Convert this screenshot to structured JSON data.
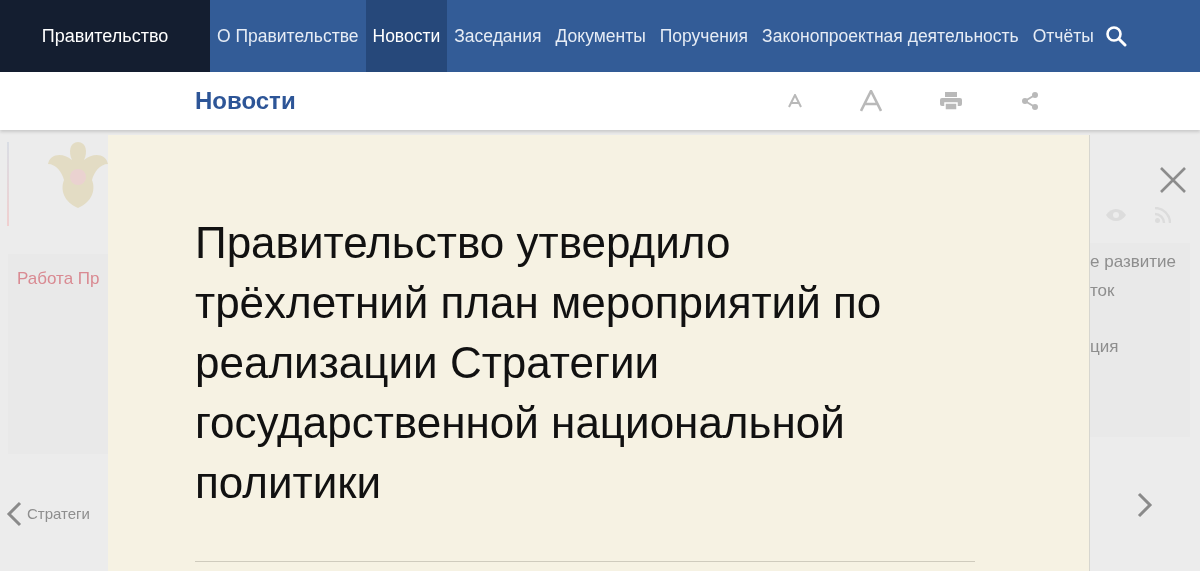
{
  "topnav": {
    "brand": "Правительство",
    "items": [
      {
        "label": "О Правительстве",
        "selected": false
      },
      {
        "label": "Новости",
        "selected": true
      },
      {
        "label": "Заседания",
        "selected": false
      },
      {
        "label": "Документы",
        "selected": false
      },
      {
        "label": "Поручения",
        "selected": false
      },
      {
        "label": "Законопроектная деятельность",
        "selected": false
      },
      {
        "label": "Отчёты",
        "selected": false
      }
    ]
  },
  "subheader": {
    "title": "Новости"
  },
  "background": {
    "left_texts": [
      {
        "text": "Работа Пр",
        "kind": "accent"
      },
      {
        "text": "Стратеги",
        "kind": "muted"
      }
    ],
    "right_texts": [
      "е развитие",
      "ток",
      "ция"
    ]
  },
  "article": {
    "headline": "Правительство утвердило трёхлетний план мероприятий по реализации Стратегии государственной национальной политики"
  }
}
